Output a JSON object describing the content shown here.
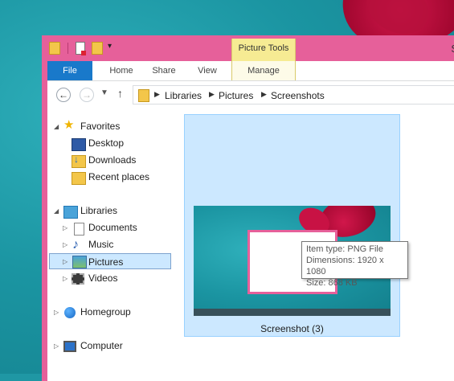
{
  "title": {
    "partial": "S"
  },
  "ribbon": {
    "contextual_group": "Picture Tools",
    "tabs": [
      "File",
      "Home",
      "Share",
      "View",
      "Manage"
    ]
  },
  "address": {
    "crumbs": [
      "Libraries",
      "Pictures",
      "Screenshots"
    ]
  },
  "nav": {
    "favorites": "Favorites",
    "desktop": "Desktop",
    "downloads": "Downloads",
    "recent": "Recent places",
    "libraries": "Libraries",
    "documents": "Documents",
    "music": "Music",
    "pictures": "Pictures",
    "videos": "Videos",
    "homegroup": "Homegroup",
    "computer": "Computer"
  },
  "file": {
    "name": "Screenshot (3)",
    "tooltip": {
      "type": "Item type: PNG File",
      "dimensions": "Dimensions: 1920 x 1080",
      "size": "Size: 868 KB"
    }
  },
  "colors": {
    "window_frame": "#e6609a",
    "file_tab": "#1979ca",
    "picture_tools": "#f6eb93",
    "selection": "#cce8ff"
  }
}
